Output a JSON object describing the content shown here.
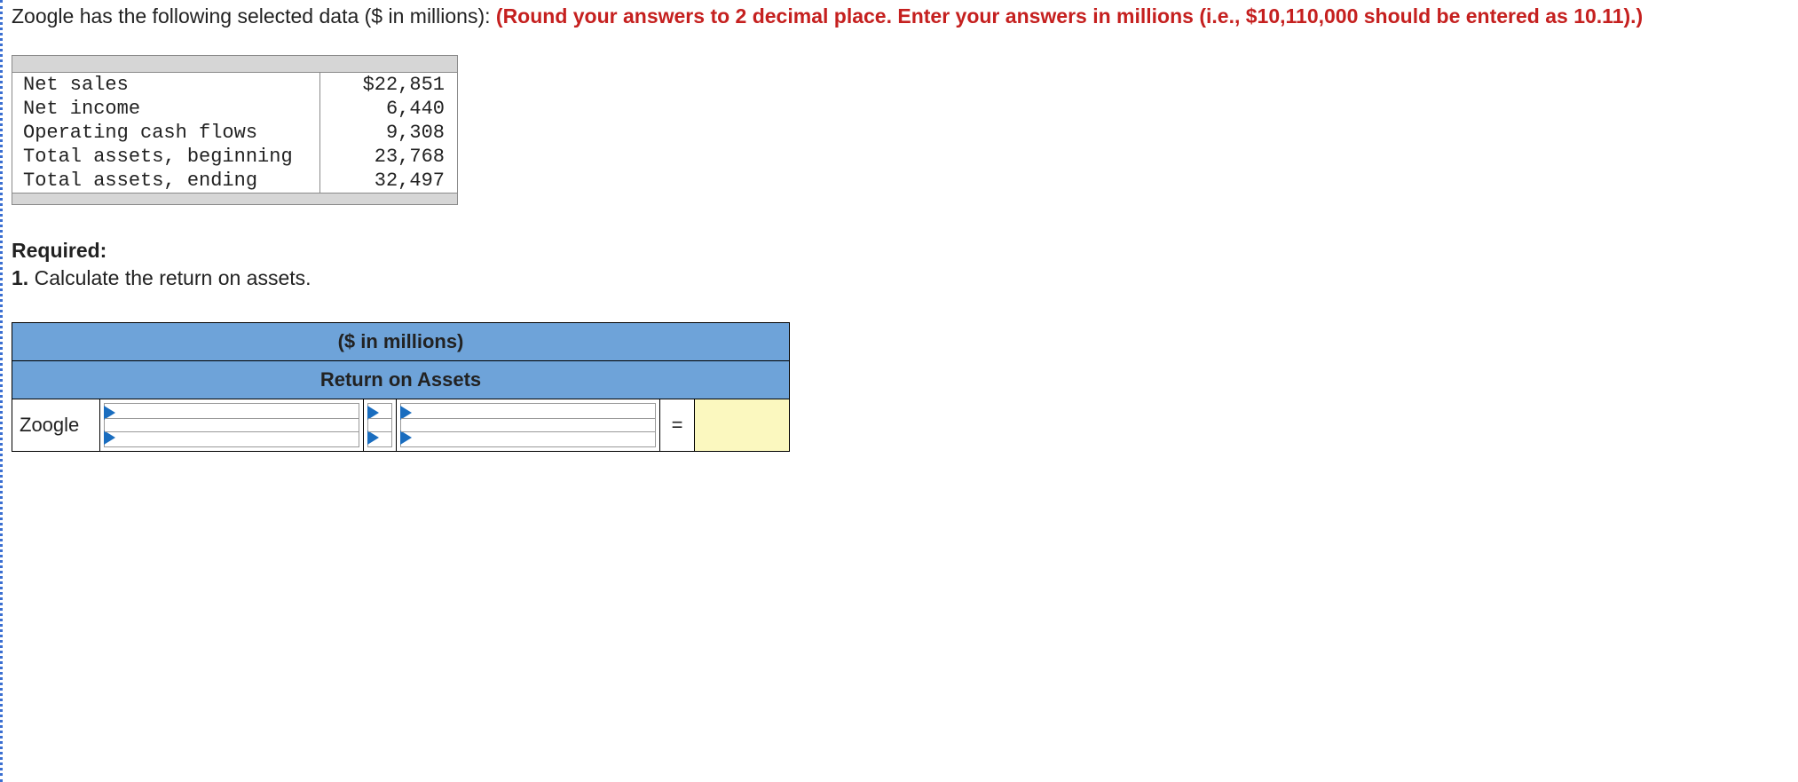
{
  "intro": {
    "text_black": "Zoogle has the following selected data ($ in millions): ",
    "text_red": "(Round your answers to 2 decimal place. Enter your answers in millions (i.e., $10,110,000 should be entered as 10.11).)"
  },
  "data_rows": [
    {
      "label": "Net sales",
      "value": "$22,851"
    },
    {
      "label": "Net income",
      "value": "6,440"
    },
    {
      "label": "Operating cash flows",
      "value": "9,308"
    },
    {
      "label": "Total assets, beginning",
      "value": "23,768"
    },
    {
      "label": "Total assets, ending",
      "value": "32,497"
    }
  ],
  "required": {
    "heading": "Required:",
    "item1": "1. Calculate the return on assets."
  },
  "answer_table": {
    "header1": "($ in millions)",
    "header2": "Return on Assets",
    "row_label": "Zoogle",
    "equals": "=",
    "numerator": "",
    "divisor": "",
    "denominator": "",
    "result": ""
  }
}
